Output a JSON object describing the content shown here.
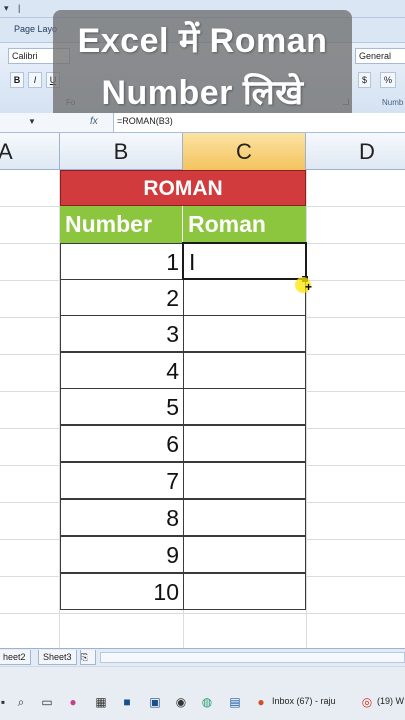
{
  "overlay": {
    "line1": "Excel में Roman",
    "line2": "Number लिखे"
  },
  "ribbon": {
    "tab_page_layout": "Page Layo",
    "font_name": "Calibri",
    "bold": "B",
    "italic": "I",
    "underline": "U",
    "font_group_label": "Fo",
    "number_format": "General",
    "currency": "$",
    "percent": "%",
    "number_group_label": "Numb"
  },
  "formula_bar": {
    "fx": "fx",
    "formula": "=ROMAN(B3)"
  },
  "columns": [
    "A",
    "B",
    "C",
    "D"
  ],
  "table": {
    "title": "ROMAN",
    "headers": [
      "Number",
      "Roman"
    ],
    "rows": [
      {
        "number": "1",
        "roman": "I"
      },
      {
        "number": "2",
        "roman": ""
      },
      {
        "number": "3",
        "roman": ""
      },
      {
        "number": "4",
        "roman": ""
      },
      {
        "number": "5",
        "roman": ""
      },
      {
        "number": "6",
        "roman": ""
      },
      {
        "number": "7",
        "roman": ""
      },
      {
        "number": "8",
        "roman": ""
      },
      {
        "number": "9",
        "roman": ""
      },
      {
        "number": "10",
        "roman": ""
      }
    ]
  },
  "sheet_tabs": [
    "heet2",
    "Sheet3"
  ],
  "taskbar": {
    "inbox": "Inbox (67) - raju",
    "browser": "(19) W"
  },
  "colors": {
    "title_red": "#d23b3e",
    "header_green": "#8cc63f",
    "selected_column": "#f5c35f"
  }
}
